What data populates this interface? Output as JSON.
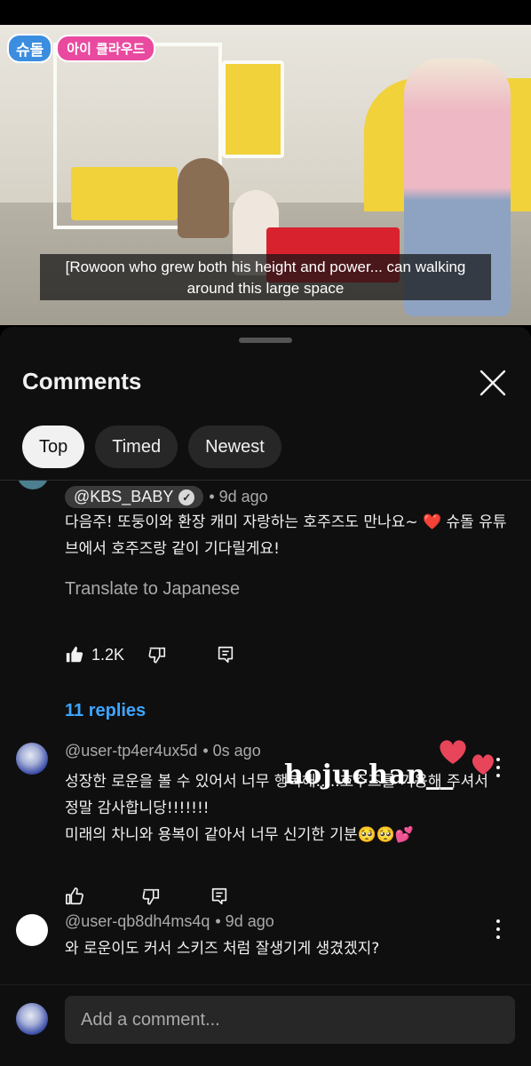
{
  "video": {
    "logo_left": "슈돌",
    "logo_right": "아이 클라우드",
    "subtitle": "[Rowoon who grew both his height and power... can walking around this large space"
  },
  "comments_sheet": {
    "title": "Comments",
    "chips": [
      {
        "label": "Top",
        "active": true
      },
      {
        "label": "Timed",
        "active": false
      },
      {
        "label": "Newest",
        "active": false
      }
    ],
    "comments": [
      {
        "handle": "@KBS_BABY",
        "verified": true,
        "time": "• 9d ago",
        "text": "다음주! 또둥이와 환장 캐미 자랑하는 호주즈도 만나요~ ❤️ 슈돌 유튜브에서 호주즈랑 같이 기다릴게요!",
        "translate": "Translate to Japanese",
        "likes": "1.2K",
        "replies": "11 replies"
      },
      {
        "handle": "@user-tp4er4ux5d",
        "time": "• 0s ago",
        "text_line1": "성장한 로운을 볼 수 있어서 너무 행복해.....호주즈를 기용해 주셔서 정말 감사합니당!!!!!!!",
        "text_line2": "미래의 차니와 용복이 같아서 너무 신기한 기분🥺🥺💕"
      },
      {
        "handle": "@user-qb8dh4ms4q",
        "time": "• 9d ago",
        "text": "와 로운이도 커서 스키즈 처럼 잘생기게 생겼겠지?"
      }
    ],
    "overlay_text": "hojuchan__",
    "add_comment_placeholder": "Add a comment..."
  },
  "icons": {
    "close": "close-icon",
    "like": "thumbs-up-icon",
    "dislike": "thumbs-down-icon",
    "reply": "reply-icon",
    "more": "more-vert-icon"
  },
  "colors": {
    "background": "#0f0f0f",
    "chip": "#272727",
    "link_blue": "#3ea6ff",
    "heart_pink": "#e8455b"
  }
}
